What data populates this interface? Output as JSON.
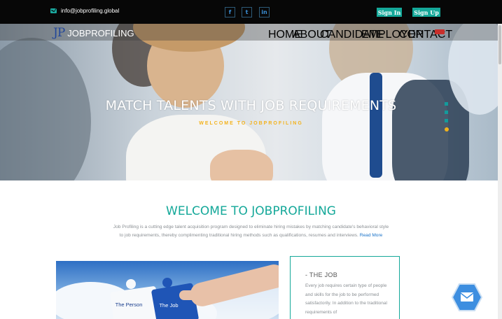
{
  "topbar": {
    "email": "info@jobprofiling.global",
    "social": [
      {
        "icon": "facebook-icon",
        "glyph": "f"
      },
      {
        "icon": "twitter-icon",
        "glyph": "t"
      },
      {
        "icon": "linkedin-icon",
        "glyph": "in"
      }
    ],
    "signin_label": "Sign In",
    "signup_label": "Sign Up"
  },
  "brand": {
    "mark": "JP",
    "name": "JOBPROFILING"
  },
  "nav": {
    "items": [
      "HOME",
      "ABOUT",
      "CANDIDATE",
      "EMPLOYER",
      "CONTACT"
    ],
    "language_flag": "flag-icon"
  },
  "hero": {
    "title": "MATCH TALENTS WITH JOB REQUIREMENTS",
    "subtitle": "WELCOME TO JOBPROFILING",
    "slides": 4,
    "active_slide": 4
  },
  "welcome": {
    "title": "WELCOME TO JOBPROFILING",
    "text": "Job Profiling is a cutting edge talent acquisition program designed to eliminate hiring mistakes by matching candidate's behavioral style to job requirements, thereby complimenting traditional hiring methods such as qualifications, resumes and interviews.",
    "read_more": "Read More"
  },
  "puzzle": {
    "piece_left": "The Person",
    "piece_right": "The Job"
  },
  "job_card": {
    "title": "- THE JOB",
    "text": "Every job requires certain type of people and skills for the job to be performed satisfactorily. In addition to the traditional requirements of"
  },
  "colors": {
    "accent": "#14a899",
    "highlight": "#f2b21b",
    "link": "#1a73c9",
    "chat": "#3d8ee0"
  }
}
